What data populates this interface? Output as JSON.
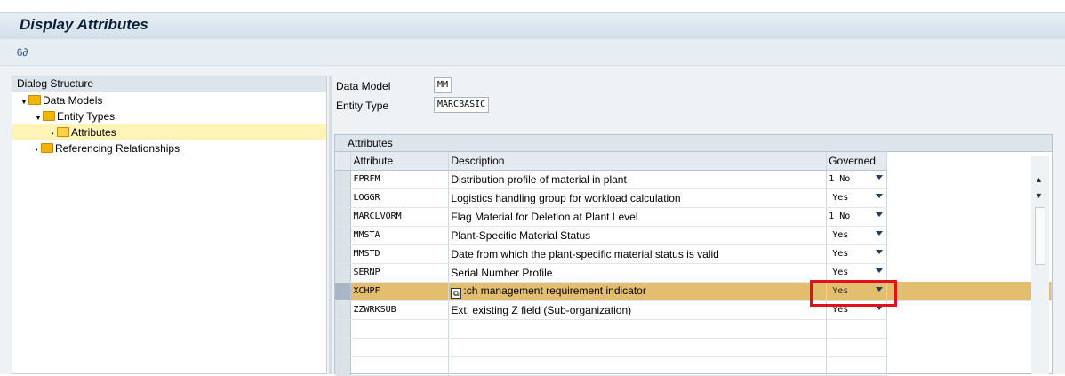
{
  "title": "Display Attributes",
  "toolbar": {
    "icon": "glasses-pencil-icon",
    "glyph": "6∂"
  },
  "tree": {
    "header": "Dialog Structure",
    "items": [
      {
        "label": "Data Models",
        "level": 0,
        "expanded": true
      },
      {
        "label": "Entity Types",
        "level": 1,
        "expanded": true
      },
      {
        "label": "Attributes",
        "level": 2,
        "expanded": true,
        "selected": true
      },
      {
        "label": "Referencing Relationships",
        "level": 0,
        "expanded": false
      }
    ]
  },
  "fields": {
    "data_model_label": "Data Model",
    "data_model_value": "MM",
    "entity_type_label": "Entity Type",
    "entity_type_value": "MARCBASIC"
  },
  "table": {
    "title": "Attributes",
    "columns": [
      "Attribute",
      "Description",
      "Governed"
    ],
    "rows": [
      {
        "attribute": "FPRFM",
        "description": "Distribution profile of material in plant",
        "governed": "1 No"
      },
      {
        "attribute": "LOGGR",
        "description": "Logistics handling group for workload calculation",
        "governed": "Yes"
      },
      {
        "attribute": "MARCLVORM",
        "description": "Flag Material for Deletion at Plant Level",
        "governed": "1 No"
      },
      {
        "attribute": "MMSTA",
        "description": "Plant-Specific Material Status",
        "governed": "Yes"
      },
      {
        "attribute": "MMSTD",
        "description": "Date from which the plant-specific material status is valid",
        "governed": "Yes"
      },
      {
        "attribute": "SERNP",
        "description": "Serial Number Profile",
        "governed": "Yes"
      },
      {
        "attribute": "XCHPF",
        "description": ":ch management requirement indicator",
        "governed": "Yes",
        "highlighted": true
      },
      {
        "attribute": "ZZWRKSUB",
        "description": "Ext: existing Z field (Sub-organization)",
        "governed": "Yes"
      }
    ]
  },
  "colors": {
    "highlight_row": "#e4be6f",
    "annotation_box": "#e2101a",
    "selected_tree": "#fff4b8"
  }
}
